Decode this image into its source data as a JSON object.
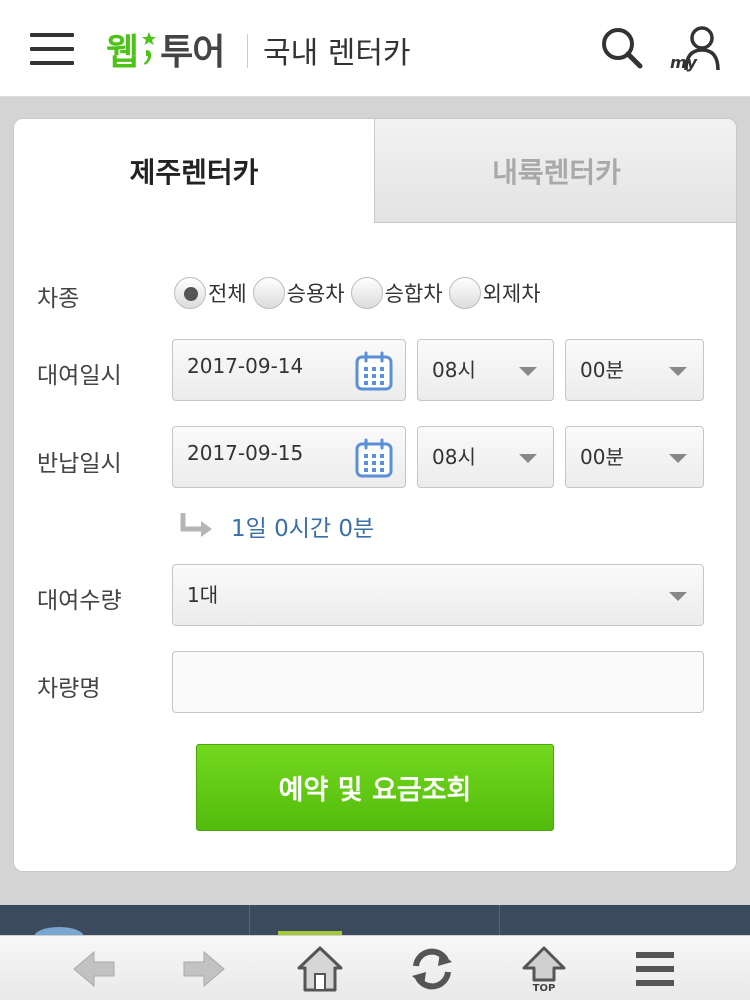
{
  "header": {
    "logo_web": "웹",
    "logo_tour": "투어",
    "title": "국내 렌터카",
    "search_icon": "search-icon",
    "my_label": "my"
  },
  "tabs": [
    {
      "label": "제주렌터카",
      "active": true
    },
    {
      "label": "내륙렌터카",
      "active": false
    }
  ],
  "form": {
    "car_type": {
      "label": "차종",
      "options": [
        "전체",
        "승용차",
        "승합차",
        "외제차"
      ],
      "selected": "전체"
    },
    "rental": {
      "label": "대여일시",
      "date": "2017-09-14",
      "hour": "08시",
      "minute": "00분"
    },
    "return": {
      "label": "반납일시",
      "date": "2017-09-15",
      "hour": "08시",
      "minute": "00분"
    },
    "duration": "1일 0시간 0분",
    "quantity": {
      "label": "대여수량",
      "value": "1대"
    },
    "car_name": {
      "label": "차량명",
      "value": ""
    },
    "submit_label": "예약 및 요금조회"
  },
  "browser_bar": {
    "top_label": "TOP",
    "icons": [
      "back-arrow-icon",
      "forward-arrow-icon",
      "home-icon",
      "refresh-icon",
      "top-icon",
      "menu-icon"
    ]
  },
  "colors": {
    "brand_green": "#4dc318",
    "button_green": "#5cc215",
    "duration_blue": "#3a6fa8",
    "calendar_blue": "#5b8fd6"
  }
}
